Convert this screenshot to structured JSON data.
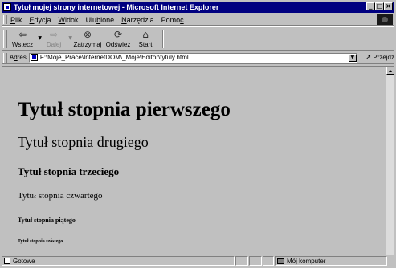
{
  "window": {
    "title": "Tytuł mojej strony internetowej - Microsoft Internet Explorer",
    "controls": {
      "minimize": "_",
      "maximize": "□",
      "close": "×"
    }
  },
  "menu": {
    "items": [
      {
        "pre": "",
        "key": "P",
        "post": "lik"
      },
      {
        "pre": "",
        "key": "E",
        "post": "dycja"
      },
      {
        "pre": "",
        "key": "W",
        "post": "idok"
      },
      {
        "pre": "Ulu",
        "key": "b",
        "post": "ione"
      },
      {
        "pre": "",
        "key": "N",
        "post": "arzędzia"
      },
      {
        "pre": "Pomo",
        "key": "c",
        "post": ""
      }
    ]
  },
  "toolbar": {
    "back": {
      "label": "Wstecz",
      "icon": "back-arrow-icon",
      "glyph": "⇦"
    },
    "forward": {
      "label": "Dalej",
      "icon": "forward-arrow-icon",
      "glyph": "⇨"
    },
    "stop": {
      "label": "Zatrzymaj",
      "icon": "stop-icon",
      "glyph": "⊗"
    },
    "refresh": {
      "label": "Odśwież",
      "icon": "refresh-icon",
      "glyph": "⟳"
    },
    "home": {
      "label": "Start",
      "icon": "home-icon",
      "glyph": "⌂"
    }
  },
  "address": {
    "label_pre": "A",
    "label_key": "d",
    "label_post": "res",
    "value": "F:\\Moje_Prace\\InternetDOM\\_Moje\\Editor\\tytuly.html",
    "go_label": "Przejdź"
  },
  "content": {
    "h1": "Tytuł stopnia pierwszego",
    "h2": "Tytuł stopnia drugiego",
    "h3": "Tytuł stopnia trzeciego",
    "h4": "Tytuł stopnia czwartego",
    "h5": "Tytuł stopnia piątego",
    "h6": "Tytuł stopnia szóstego"
  },
  "status": {
    "text": "Gotowe",
    "zone": "Mój komputer"
  },
  "colors": {
    "titlebar": "#000080",
    "chrome": "#c0c0c0"
  }
}
